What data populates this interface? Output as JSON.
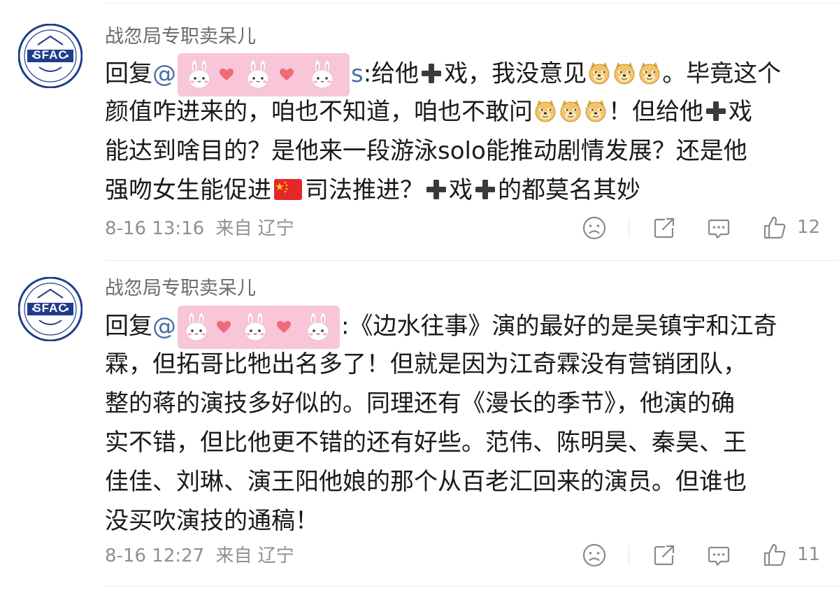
{
  "comments": [
    {
      "author": "战忽局专职卖呆儿",
      "avatar_text": "SFAC",
      "reply_prefix": "回复",
      "mention_start": "@",
      "mention_mid": "",
      "mention_end": "s",
      "lines": {
        "l1a": ":给他",
        "l1b": "戏，我没意见",
        "l1c": "。毕竟这个",
        "l2a": "颜值咋进来的，咱也不知道，咱也不敢问",
        "l2b": "！但给他",
        "l2c": "戏",
        "l3": "能达到啥目的？是他来一段游泳solo能推动剧情发展？还是他",
        "l4a": "强吻女生能促进",
        "l4b": "司法推进？",
        "l4c": "戏",
        "l4d": "的都莫名其妙"
      },
      "time": "8-16 13:16",
      "source": "来自 辽宁",
      "likes": "12"
    },
    {
      "author": "战忽局专职卖呆儿",
      "avatar_text": "SFAC",
      "reply_prefix": "回复",
      "mention_start": "@",
      "lines": {
        "l1": ":《边水往事》演的最好的是吴镇宇和江奇",
        "l2": "霖，但拓哥比牠出名多了！但就是因为江奇霖没有营销团队，",
        "l3": "整的蒋的演技多好似的。同理还有《漫长的季节》，他演的确",
        "l4": "实不错，但比他更不错的还有好些。范伟、陈明昊、秦昊、王",
        "l5": "佳佳、刘琳、演王阳他娘的那个从百老汇回来的演员。但谁也",
        "l6": "没买吹演技的通稿！"
      },
      "time": "8-16 12:27",
      "source": "来自 辽宁",
      "likes": "11"
    }
  ],
  "icons": {
    "sticker": "bunny-heart-sticker",
    "doge": "doge-emoji",
    "plus": "heavy-plus-emoji",
    "flag": "china-flag-emoji",
    "dislike": "sad-face-icon",
    "share": "share-icon",
    "reply": "comment-bubble-icon",
    "like": "thumbs-up-icon"
  },
  "colors": {
    "author": "#6b6b6b",
    "mention": "#4a6fa5",
    "meta": "#8f8f8f",
    "sticker_bg": "#f8c6d8",
    "heart": "#f06a7a",
    "avatar_blue": "#1f3d8a"
  }
}
